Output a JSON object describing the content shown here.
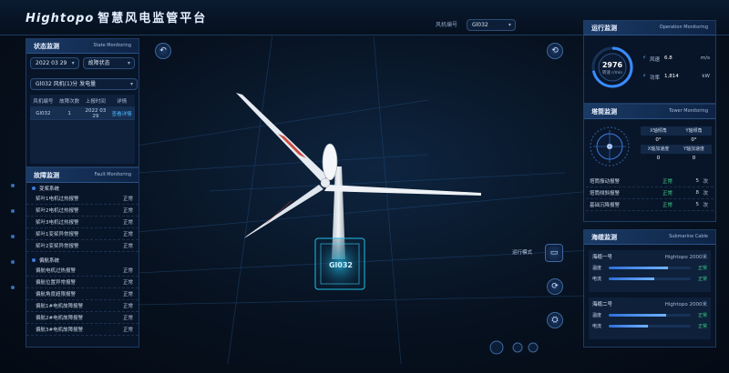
{
  "header": {
    "logo_brand": "Hightopo",
    "logo_title": "智慧风电监管平台",
    "turbine_label": "风机编号",
    "turbine_value": "Gl032"
  },
  "colors": {
    "accent": "#3a7be0",
    "ok": "#3fd18a",
    "link": "#4fb7ff",
    "blade_red": "#c9473f"
  },
  "left": {
    "status": {
      "title": "状态监测",
      "en": "State Monitoring",
      "date_value": "2022 03 29",
      "mode_value": "故障状态",
      "fault_value": "Gl032 风机(1)分 发电量",
      "columns": [
        "风机编号",
        "故障次数",
        "上报时间",
        "详情"
      ],
      "rows": [
        [
          "Gl032",
          "1",
          "2022 03 29",
          "查看详情"
        ]
      ]
    },
    "fault": {
      "title": "故障监测",
      "en": "Fault Monitoring",
      "groups": [
        {
          "name": "变桨系统",
          "items": [
            {
              "label": "桨叶1电机过热报警",
              "value": "正常"
            },
            {
              "label": "桨叶2电机过热报警",
              "value": "正常"
            },
            {
              "label": "桨叶3电机过热报警",
              "value": "正常"
            },
            {
              "label": "桨叶1变桨异常报警",
              "value": "正常"
            },
            {
              "label": "桨叶2变桨异常报警",
              "value": "正常"
            }
          ]
        },
        {
          "name": "偏航系统",
          "items": [
            {
              "label": "偏航电机过热报警",
              "value": "正常"
            },
            {
              "label": "偏航位置异常报警",
              "value": "正常"
            },
            {
              "label": "偏航角度超限报警",
              "value": "正常"
            },
            {
              "label": "偏航1#电机故障报警",
              "value": "正常"
            },
            {
              "label": "偏航2#电机故障报警",
              "value": "正常"
            },
            {
              "label": "偏航3#电机故障报警",
              "value": "正常"
            }
          ]
        }
      ]
    }
  },
  "right": {
    "ops": {
      "title": "运行监测",
      "en": "Operation Monitoring",
      "gauge_value": "2976",
      "gauge_unit": "转速 r/min",
      "rows": [
        {
          "icon": "⚡",
          "label": "风速",
          "value": "6.8",
          "unit": "m/s"
        },
        {
          "icon": "⚡",
          "label": "功率",
          "value": "1,814",
          "unit": "kW"
        }
      ]
    },
    "tower": {
      "title": "塔筒监测",
      "en": "Tower Monitoring",
      "grid": [
        [
          "X轴倾角",
          "Y轴倾角"
        ],
        [
          "0°",
          "0°"
        ],
        [
          "X轴加速度",
          "Y轴加速度"
        ],
        [
          "0",
          "0"
        ]
      ],
      "list": [
        {
          "label": "塔筒振动报警",
          "status": "正常",
          "value": "5",
          "unit": "次"
        },
        {
          "label": "塔筒倾斜报警",
          "status": "正常",
          "value": "8",
          "unit": "次"
        },
        {
          "label": "基础沉降报警",
          "status": "正常",
          "value": "5",
          "unit": "次"
        }
      ]
    },
    "cable": {
      "title": "海缆监测",
      "en": "Submarine Cable",
      "cards": [
        {
          "name": "海缆一号",
          "brand": "Hightopo 2000米",
          "rows": [
            {
              "label": "温度",
              "pct": 0.72,
              "value": "正常"
            },
            {
              "label": "电流",
              "pct": 0.55,
              "value": "正常"
            }
          ]
        },
        {
          "name": "海缆二号",
          "brand": "Hightopo 2000米",
          "rows": [
            {
              "label": "温度",
              "pct": 0.7,
              "value": "正常"
            },
            {
              "label": "电流",
              "pct": 0.48,
              "value": "正常"
            }
          ]
        }
      ]
    }
  },
  "center": {
    "hub_label": "Gl032",
    "view_label": "运行模式"
  }
}
